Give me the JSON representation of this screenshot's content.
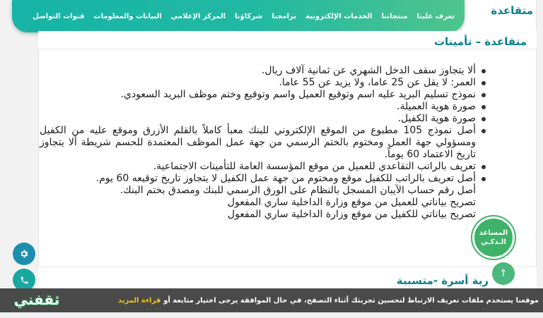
{
  "behind_title": "متقاعدة",
  "nav": {
    "items": [
      "تعرف علينا",
      "منتجاتنا",
      "الخدمات الإلكترونية",
      "برامجنا",
      "شركاؤنا",
      "المركز الإعلامي",
      "البيانات والمعلومات",
      "قنوات التواصل"
    ]
  },
  "section": {
    "title": "متقاعدة – تأمينات",
    "items": [
      {
        "text": "ألا يتجاوز سقف الدخل الشهري عن ثمانية آلاف ريال.",
        "bullet": true
      },
      {
        "text": "العمر: لا يقل عن  25  عاما، ولا يزيد عن  55 عاما.",
        "bullet": true
      },
      {
        "text": "نموذج تسليم البريد عليه اسم وتوقيع العميل واسم وتوقيع وختم موظف البريد السعودي.",
        "bullet": true
      },
      {
        "text": "صورة هوية العميلة.",
        "bullet": true
      },
      {
        "text": "صورة هوية الكفيل.",
        "bullet": true
      },
      {
        "text": "أصل نموذج  105  مطبوع من الموقع الإلكتروني للبنك معبأ كاملاً بالقلم الأزرق وموقع عليه من الكفيل ومسؤولي جهة العمل ومختوم بالختم الرسمي من جهة عمل الموظف المعتمدة للحسم شريطة ألا يتجاوز تاريخ الاعتماد  60  يوماً.",
        "bullet": true
      },
      {
        "text": "تعريف بالراتب التقاعدي للعميل من موقع المؤسسة العامة للتأمينات الاجتماعية.",
        "bullet": true
      },
      {
        "text": "أصل تعريف بالراتب للكفيل موقع ومختوم من جهة عمل الكفيل لا يتجاوز تاريخ توقيعه  60  يوم.",
        "bullet": true
      },
      {
        "text": "أصل رقم حساب الآيبان المسجل بالنظام على الورق الرسمي للبنك ومصدق بختم البنك.",
        "bullet": false
      },
      {
        "text": "تصريح بياناتي للعميل من موقع وزارة الداخلية ساري المفعول",
        "bullet": false
      },
      {
        "text": "تصريح بياناتي للكفيل من موقع وزارة الداخلية ساري المفعول",
        "bullet": false
      }
    ]
  },
  "section2": {
    "title": "ربة أسرة -متسببة"
  },
  "assistant": {
    "line1": "المساعد",
    "line2": "الـذكـي"
  },
  "scroll_top": "↑",
  "cookie": {
    "text": "موقعنا يستخدم ملفات تعريف الارتباط لتحسين تجربتك أثناء التصفح، في حال الموافقة يرجى اختيار متابعة أو",
    "link": "قراءة المزيد"
  },
  "logo": {
    "text": "ثقفني"
  },
  "colors": {
    "teal": "#0a7f8c",
    "nav_start": "#16b4a6",
    "nav_end": "#4fc48c",
    "assistant": "#3fb26a",
    "cookie_bg": "#4a4a4a",
    "cookie_link": "#f1c40f"
  },
  "icons": {
    "settings": "gear-icon",
    "phone": "phone-icon",
    "scroll": "arrow-up-icon"
  }
}
